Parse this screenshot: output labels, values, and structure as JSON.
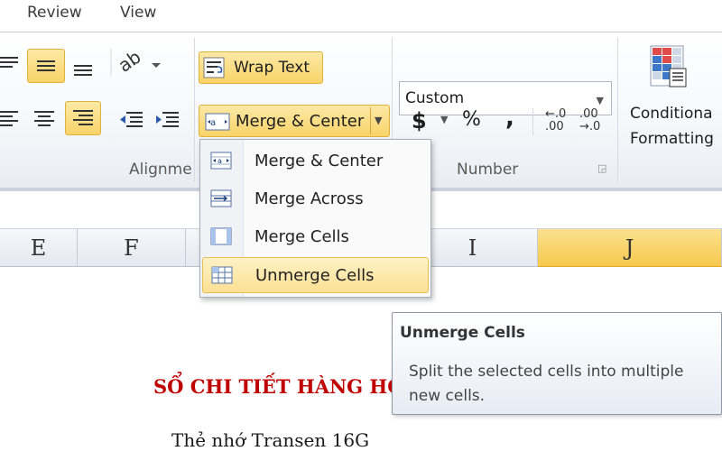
{
  "ribbon_tabs": [
    "Review",
    "View"
  ],
  "alignment_group": {
    "wrap_text_label": "Wrap Text",
    "merge_center_label": "Merge & Center",
    "group_label": "Alignme"
  },
  "number_group": {
    "format_value": "Custom",
    "currency_symbol": "$",
    "percent_symbol": "%",
    "comma_symbol": ",",
    "increase_decimal_top": "←.0",
    "increase_decimal_bottom": ".00",
    "decrease_decimal_top": ".00",
    "decrease_decimal_bottom": "→.0",
    "group_label": "Number"
  },
  "styles_group": {
    "conditional_formatting_line1": "Conditiona",
    "conditional_formatting_line2": "Formatting"
  },
  "column_headers": [
    "E",
    "F",
    "I",
    "J"
  ],
  "selected_column": "J",
  "merge_menu": {
    "items": [
      {
        "label": "Merge & Center",
        "icon": "merge-center-icon"
      },
      {
        "label": "Merge Across",
        "icon": "merge-across-icon"
      },
      {
        "label": "Merge Cells",
        "icon": "merge-cells-icon"
      },
      {
        "label": "Unmerge Cells",
        "icon": "unmerge-cells-icon"
      }
    ],
    "hovered_index": 3
  },
  "tooltip": {
    "title": "Unmerge Cells",
    "body": "Split the selected cells into multiple new cells."
  },
  "sheet": {
    "title": "SỔ CHI TIẾT HÀNG HÓ",
    "subtitle": "Thẻ nhớ Transen 16G"
  },
  "colors": {
    "highlight": "#f8d368",
    "sheet_title": "#c00000",
    "selected_header": "#f6c94e"
  }
}
